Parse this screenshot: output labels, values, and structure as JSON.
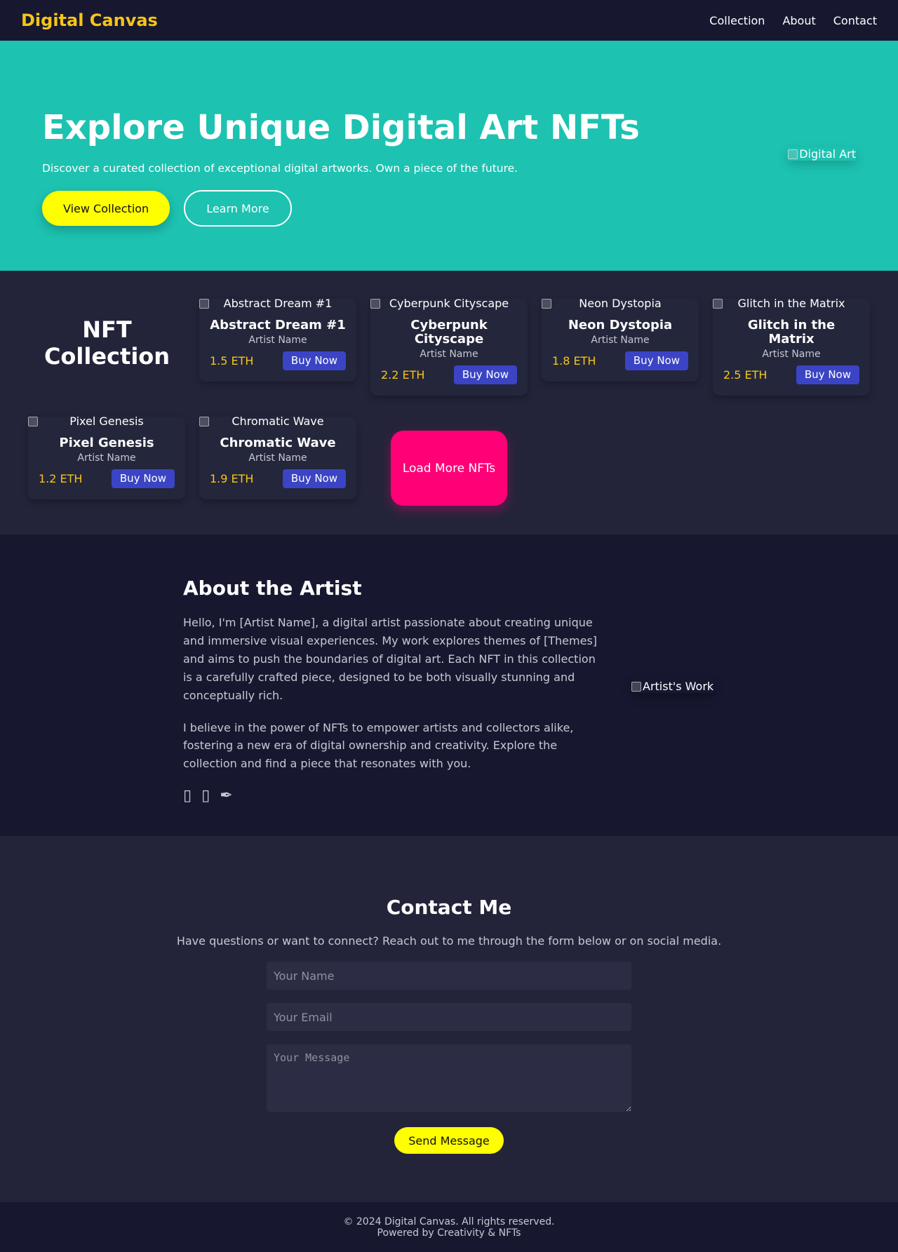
{
  "nav": {
    "brand": "Digital Canvas",
    "links": [
      "Collection",
      "About",
      "Contact"
    ]
  },
  "hero": {
    "title": "Explore Unique Digital Art NFTs",
    "subtitle": "Discover a curated collection of exceptional digital artworks. Own a piece of the future.",
    "primary_button": "View Collection",
    "secondary_button": "Learn More",
    "image_alt": "Digital Art"
  },
  "collection": {
    "title": "NFT Collection",
    "buy_label": "Buy Now",
    "load_more": "Load More NFTs",
    "items": [
      {
        "image_alt": "Abstract Dream #1",
        "title": "Abstract Dream #1",
        "artist": "Artist Name",
        "price": "1.5 ETH"
      },
      {
        "image_alt": "Cyberpunk Cityscape",
        "title": "Cyberpunk Cityscape",
        "artist": "Artist Name",
        "price": "2.2 ETH"
      },
      {
        "image_alt": "Neon Dystopia",
        "title": "Neon Dystopia",
        "artist": "Artist Name",
        "price": "1.8 ETH"
      },
      {
        "image_alt": "Glitch in the Matrix",
        "title": "Glitch in the Matrix",
        "artist": "Artist Name",
        "price": "2.5 ETH"
      },
      {
        "image_alt": "Pixel Genesis",
        "title": "Pixel Genesis",
        "artist": "Artist Name",
        "price": "1.2 ETH"
      },
      {
        "image_alt": "Chromatic Wave",
        "title": "Chromatic Wave",
        "artist": "Artist Name",
        "price": "1.9 ETH"
      }
    ]
  },
  "about": {
    "title": "About the Artist",
    "paragraph1": "Hello, I'm [Artist Name], a digital artist passionate about creating unique and immersive visual experiences. My work explores themes of [Themes] and aims to push the boundaries of digital art. Each NFT in this collection is a carefully crafted piece, designed to be both visually stunning and conceptually rich.",
    "paragraph2": "I believe in the power of NFTs to empower artists and collectors alike, fostering a new era of digital ownership and creativity. Explore the collection and find a piece that resonates with you.",
    "image_alt": "Artist's Work",
    "social_icons": [
      "twitter-icon",
      "instagram-icon",
      "pen-icon"
    ]
  },
  "contact": {
    "title": "Contact Me",
    "subtitle": "Have questions or want to connect? Reach out to me through the form below or on social media.",
    "name_placeholder": "Your Name",
    "email_placeholder": "Your Email",
    "message_placeholder": "Your Message",
    "send_button": "Send Message"
  },
  "footer": {
    "copyright": "© 2024 Digital Canvas. All rights reserved.",
    "powered": "Powered by Creativity & NFTs"
  },
  "colors": {
    "accent_yellow": "#f5c518",
    "hero_teal": "#1dc2b1",
    "buy_blue": "#3b44c4",
    "load_more_pink": "#ff0077"
  }
}
